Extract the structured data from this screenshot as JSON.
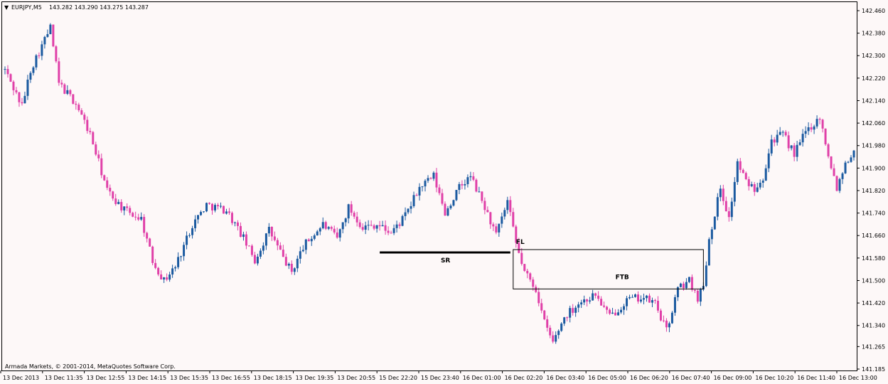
{
  "header": {
    "triangle": "▼",
    "symbol": "EURJPY,M5",
    "ohlc": "143.282 143.290 143.275 143.287"
  },
  "footer": {
    "copyright": "Armada Markets, © 2001-2014, MetaQuotes Software Corp."
  },
  "colors": {
    "background": "#fdf8f8",
    "bull": "#1b5aa0",
    "bear": "#e040a8",
    "line": "#000000"
  },
  "chart_data": {
    "type": "candlestick",
    "ylim": [
      141.185,
      142.5
    ],
    "y_ticks": [
      "142.460",
      "142.380",
      "142.300",
      "142.220",
      "142.140",
      "142.060",
      "141.980",
      "141.900",
      "141.820",
      "141.740",
      "141.660",
      "141.580",
      "141.500",
      "141.420",
      "141.340",
      "141.265",
      "141.185"
    ],
    "x_ticks": [
      "13 Dec 2013",
      "13 Dec 11:35",
      "13 Dec 12:55",
      "13 Dec 14:15",
      "13 Dec 15:35",
      "13 Dec 16:55",
      "13 Dec 18:15",
      "13 Dec 19:35",
      "13 Dec 20:55",
      "15 Dec 22:20",
      "15 Dec 23:40",
      "16 Dec 01:00",
      "16 Dec 02:20",
      "16 Dec 03:40",
      "16 Dec 05:00",
      "16 Dec 06:20",
      "16 Dec 07:40",
      "16 Dec 09:00",
      "16 Dec 10:20",
      "16 Dec 11:40",
      "16 Dec 13:00"
    ],
    "anchors": [
      {
        "bar": 0,
        "price": 142.25
      },
      {
        "bar": 6,
        "price": 142.12
      },
      {
        "bar": 9,
        "price": 142.25
      },
      {
        "bar": 16,
        "price": 142.4
      },
      {
        "bar": 19,
        "price": 142.2
      },
      {
        "bar": 25,
        "price": 142.13
      },
      {
        "bar": 30,
        "price": 142.02
      },
      {
        "bar": 36,
        "price": 141.82
      },
      {
        "bar": 42,
        "price": 141.75
      },
      {
        "bar": 48,
        "price": 141.72
      },
      {
        "bar": 52,
        "price": 141.57
      },
      {
        "bar": 56,
        "price": 141.5
      },
      {
        "bar": 60,
        "price": 141.55
      },
      {
        "bar": 66,
        "price": 141.7
      },
      {
        "bar": 71,
        "price": 141.77
      },
      {
        "bar": 78,
        "price": 141.75
      },
      {
        "bar": 84,
        "price": 141.65
      },
      {
        "bar": 88,
        "price": 141.57
      },
      {
        "bar": 93,
        "price": 141.68
      },
      {
        "bar": 98,
        "price": 141.58
      },
      {
        "bar": 101,
        "price": 141.53
      },
      {
        "bar": 105,
        "price": 141.62
      },
      {
        "bar": 112,
        "price": 141.7
      },
      {
        "bar": 117,
        "price": 141.65
      },
      {
        "bar": 121,
        "price": 141.76
      },
      {
        "bar": 126,
        "price": 141.69
      },
      {
        "bar": 131,
        "price": 141.7
      },
      {
        "bar": 136,
        "price": 141.67
      },
      {
        "bar": 141,
        "price": 141.73
      },
      {
        "bar": 146,
        "price": 141.83
      },
      {
        "bar": 151,
        "price": 141.87
      },
      {
        "bar": 155,
        "price": 141.74
      },
      {
        "bar": 160,
        "price": 141.83
      },
      {
        "bar": 164,
        "price": 141.87
      },
      {
        "bar": 169,
        "price": 141.76
      },
      {
        "bar": 173,
        "price": 141.66
      },
      {
        "bar": 177,
        "price": 141.78
      },
      {
        "bar": 180,
        "price": 141.63
      },
      {
        "bar": 183,
        "price": 141.53
      },
      {
        "bar": 187,
        "price": 141.47
      },
      {
        "bar": 190,
        "price": 141.35
      },
      {
        "bar": 193,
        "price": 141.28
      },
      {
        "bar": 197,
        "price": 141.37
      },
      {
        "bar": 202,
        "price": 141.42
      },
      {
        "bar": 208,
        "price": 141.45
      },
      {
        "bar": 213,
        "price": 141.37
      },
      {
        "bar": 219,
        "price": 141.43
      },
      {
        "bar": 224,
        "price": 141.44
      },
      {
        "bar": 229,
        "price": 141.42
      },
      {
        "bar": 233,
        "price": 141.32
      },
      {
        "bar": 237,
        "price": 141.47
      },
      {
        "bar": 241,
        "price": 141.5
      },
      {
        "bar": 244,
        "price": 141.44
      },
      {
        "bar": 246,
        "price": 141.48
      },
      {
        "bar": 248,
        "price": 141.65
      },
      {
        "bar": 252,
        "price": 141.83
      },
      {
        "bar": 255,
        "price": 141.72
      },
      {
        "bar": 258,
        "price": 141.92
      },
      {
        "bar": 261,
        "price": 141.85
      },
      {
        "bar": 264,
        "price": 141.83
      },
      {
        "bar": 267,
        "price": 141.87
      },
      {
        "bar": 270,
        "price": 142.0
      },
      {
        "bar": 274,
        "price": 142.02
      },
      {
        "bar": 278,
        "price": 141.95
      },
      {
        "bar": 282,
        "price": 142.03
      },
      {
        "bar": 287,
        "price": 142.08
      },
      {
        "bar": 290,
        "price": 141.95
      },
      {
        "bar": 293,
        "price": 141.83
      },
      {
        "bar": 296,
        "price": 141.92
      },
      {
        "bar": 298,
        "price": 141.95
      }
    ],
    "annotations": [
      {
        "label": "SR",
        "x1_bar": 132,
        "x2_bar": 178,
        "price": 141.6,
        "type": "segment"
      },
      {
        "label": "FL",
        "x1_bar": 179,
        "x2_bar": 246,
        "price": 141.61,
        "type": "box_top"
      },
      {
        "label": "FTB",
        "x1_bar": 179,
        "x2_bar": 246,
        "price": 141.47,
        "type": "box_bottom"
      }
    ]
  }
}
